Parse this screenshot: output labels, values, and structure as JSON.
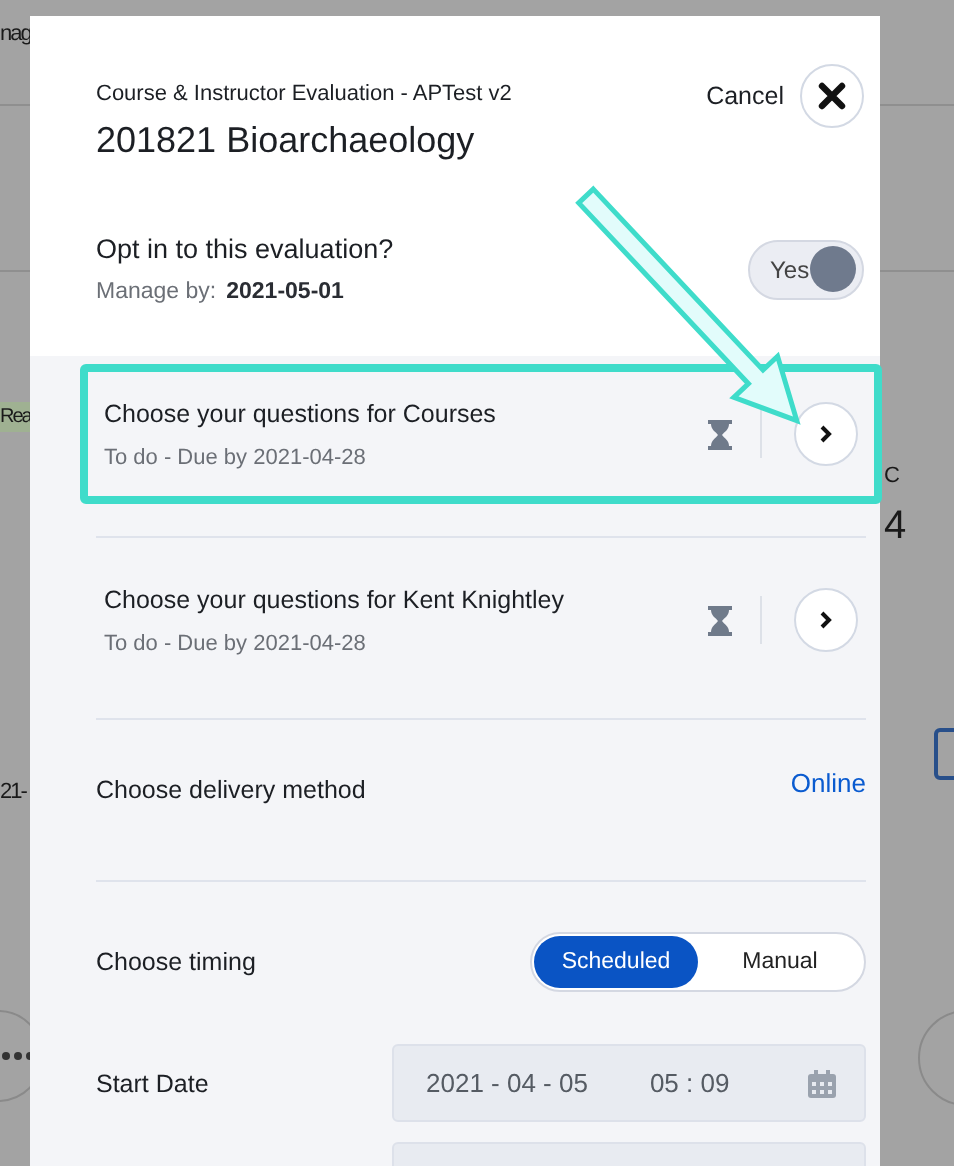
{
  "background": {
    "fragments": [
      {
        "kind": "text",
        "text": "nag"
      },
      {
        "kind": "badge",
        "text": "Rea"
      },
      {
        "kind": "text",
        "text": "21-"
      },
      {
        "kind": "text",
        "text": "C"
      },
      {
        "kind": "big",
        "text": "4"
      }
    ]
  },
  "dialog": {
    "subtitle": "Course & Instructor Evaluation - APTest v2",
    "title": "201821 Bioarchaeology",
    "cancel": "Cancel",
    "opt_in": {
      "label": "Opt in to this evaluation?",
      "manage_label": "Manage by:",
      "manage_date": "2021-05-01",
      "toggle": {
        "label": "Yes",
        "on": true
      }
    },
    "rows": [
      {
        "kind": "task",
        "title": "Choose your questions for Courses",
        "status": "To do - Due by 2021-04-28",
        "highlighted": true
      },
      {
        "kind": "task",
        "title": "Choose your questions for Kent Knightley",
        "status": "To do - Due by 2021-04-28",
        "highlighted": false
      },
      {
        "kind": "link",
        "label": "Choose delivery method",
        "value": "Online"
      },
      {
        "kind": "segmented",
        "label": "Choose timing",
        "options": [
          {
            "label": "Scheduled",
            "selected": true
          },
          {
            "label": "Manual",
            "selected": false
          }
        ]
      },
      {
        "kind": "datetime",
        "label": "Start Date",
        "date": "2021 - 04 - 05",
        "time": "05 : 09"
      }
    ]
  }
}
